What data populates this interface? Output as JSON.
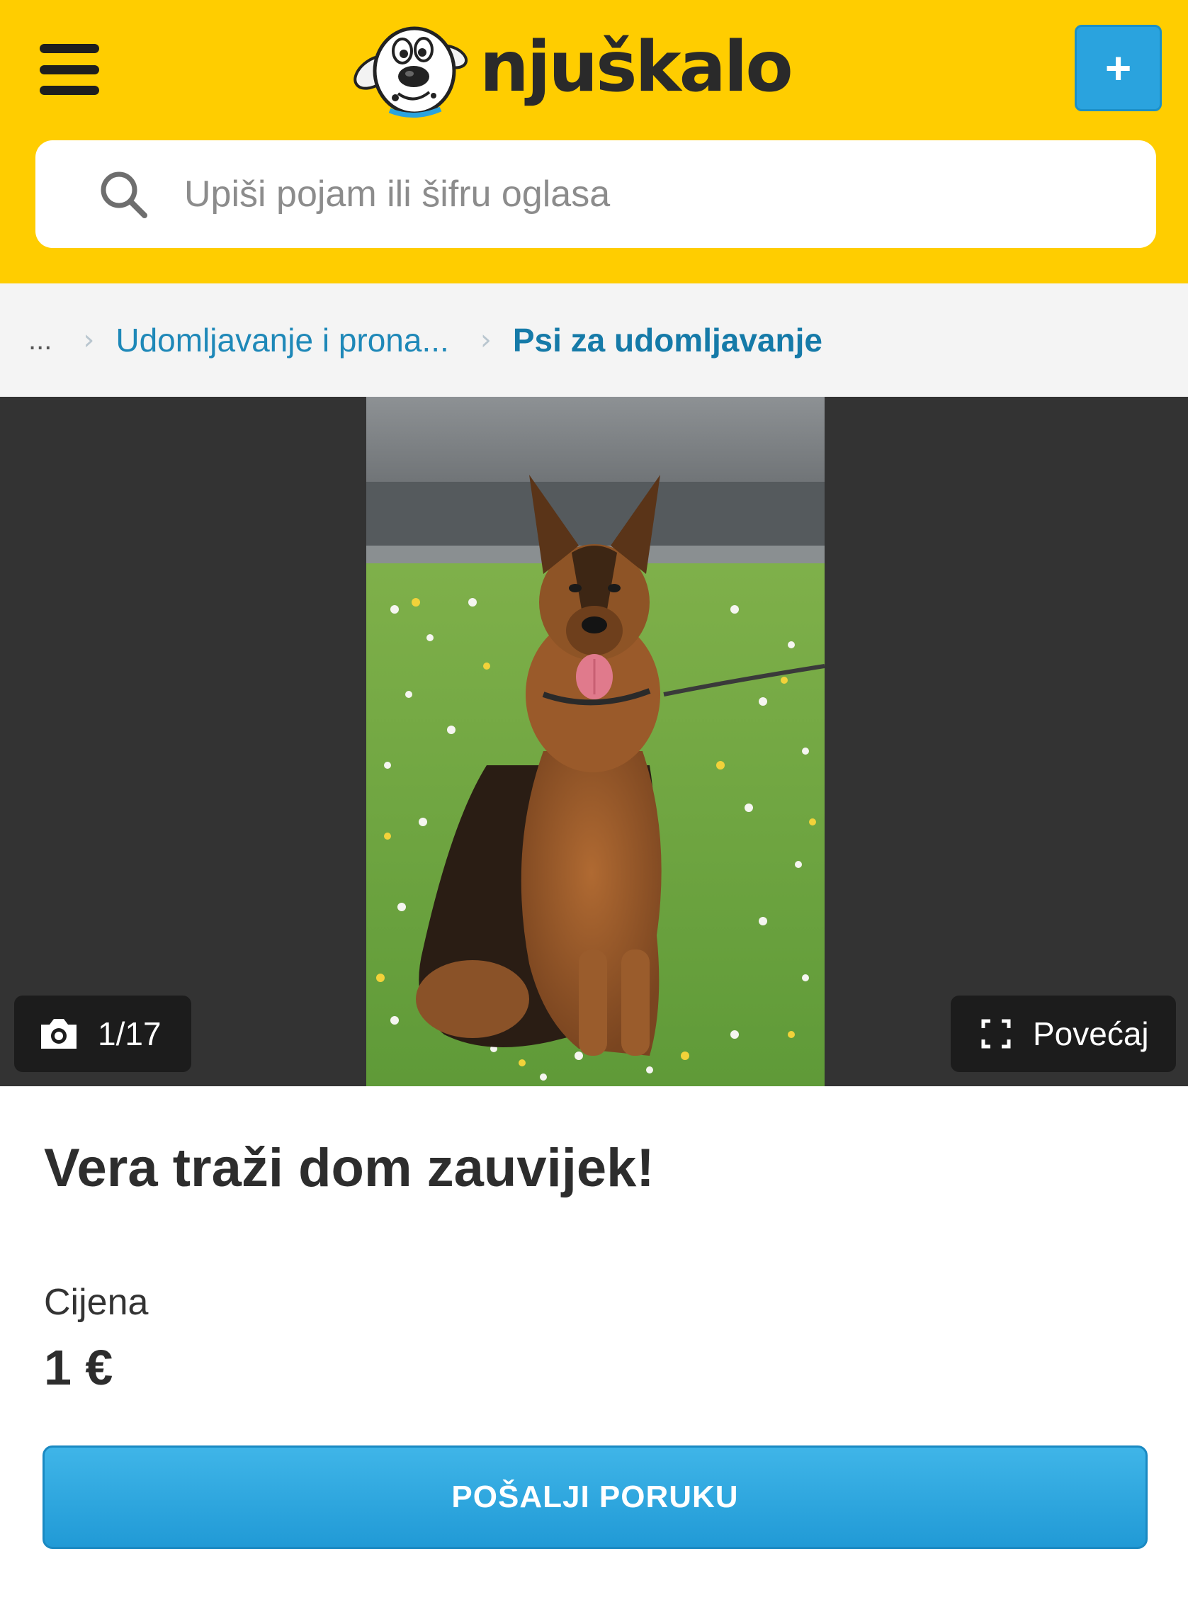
{
  "header": {
    "logo_text": "njuškalo",
    "add_button_label": "+",
    "search": {
      "placeholder": "Upiši pojam ili šifru oglasa",
      "value": ""
    }
  },
  "breadcrumb": {
    "ellipsis": "...",
    "items": [
      {
        "label": "Udomljavanje i prona..."
      },
      {
        "label": "Psi za udomljavanje"
      }
    ]
  },
  "gallery": {
    "counter": "1/17",
    "enlarge_label": "Povećaj"
  },
  "listing": {
    "title": "Vera traži dom zauvijek!",
    "price_label": "Cijena",
    "price_value": "1 €",
    "send_message_label": "POŠALJI PORUKU"
  },
  "colors": {
    "brand_yellow": "#ffcd00",
    "accent_blue": "#2aa3de",
    "link_blue": "#1e88b8"
  }
}
